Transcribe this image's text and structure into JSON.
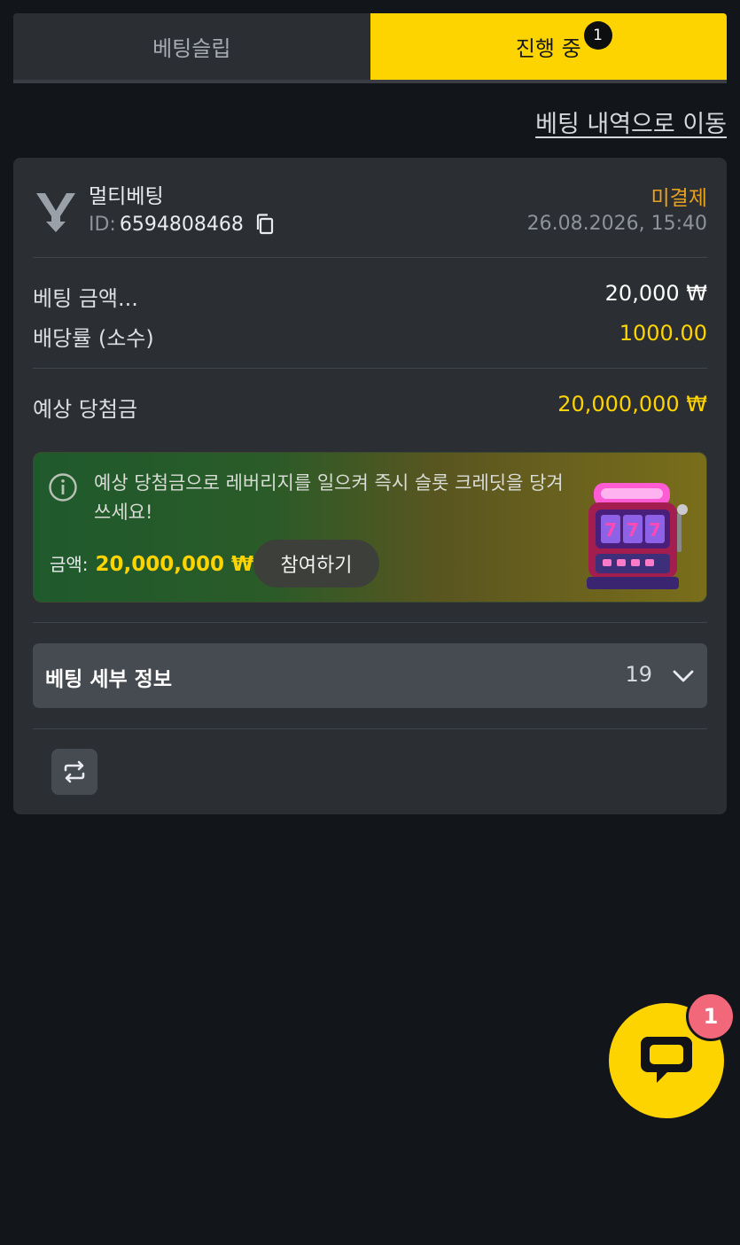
{
  "tabs": {
    "betslip": "베팅슬립",
    "in_progress": "진행 중",
    "in_progress_count": "1"
  },
  "history_link": "베팅 내역으로 이동",
  "bet": {
    "type": "멀티베팅",
    "id_label": "ID:",
    "id": "6594808468",
    "status": "미결제",
    "datetime": "26.08.2026, 15:40",
    "stake_label": "베팅 금액...",
    "stake": "20,000 ₩",
    "odds_label": "배당률 (소수)",
    "odds": "1000.00",
    "potential_label": "예상 당첨금",
    "potential": "20,000,000 ₩"
  },
  "promo": {
    "text": "예상 당첨금으로 레버리지를 일으켜 즉시 슬롯 크레딧을 당겨 쓰세요!",
    "amount_label": "금액:",
    "amount": "20,000,000 ₩",
    "join_label": "참여하기",
    "icon": "slot-machine-icon"
  },
  "details": {
    "title": "베팅 세부 정보",
    "count": "19"
  },
  "chat": {
    "badge": "1"
  },
  "colors": {
    "accent": "#fed400",
    "status": "#e8a21e",
    "background": "#12151a",
    "card": "#2b2e33"
  }
}
